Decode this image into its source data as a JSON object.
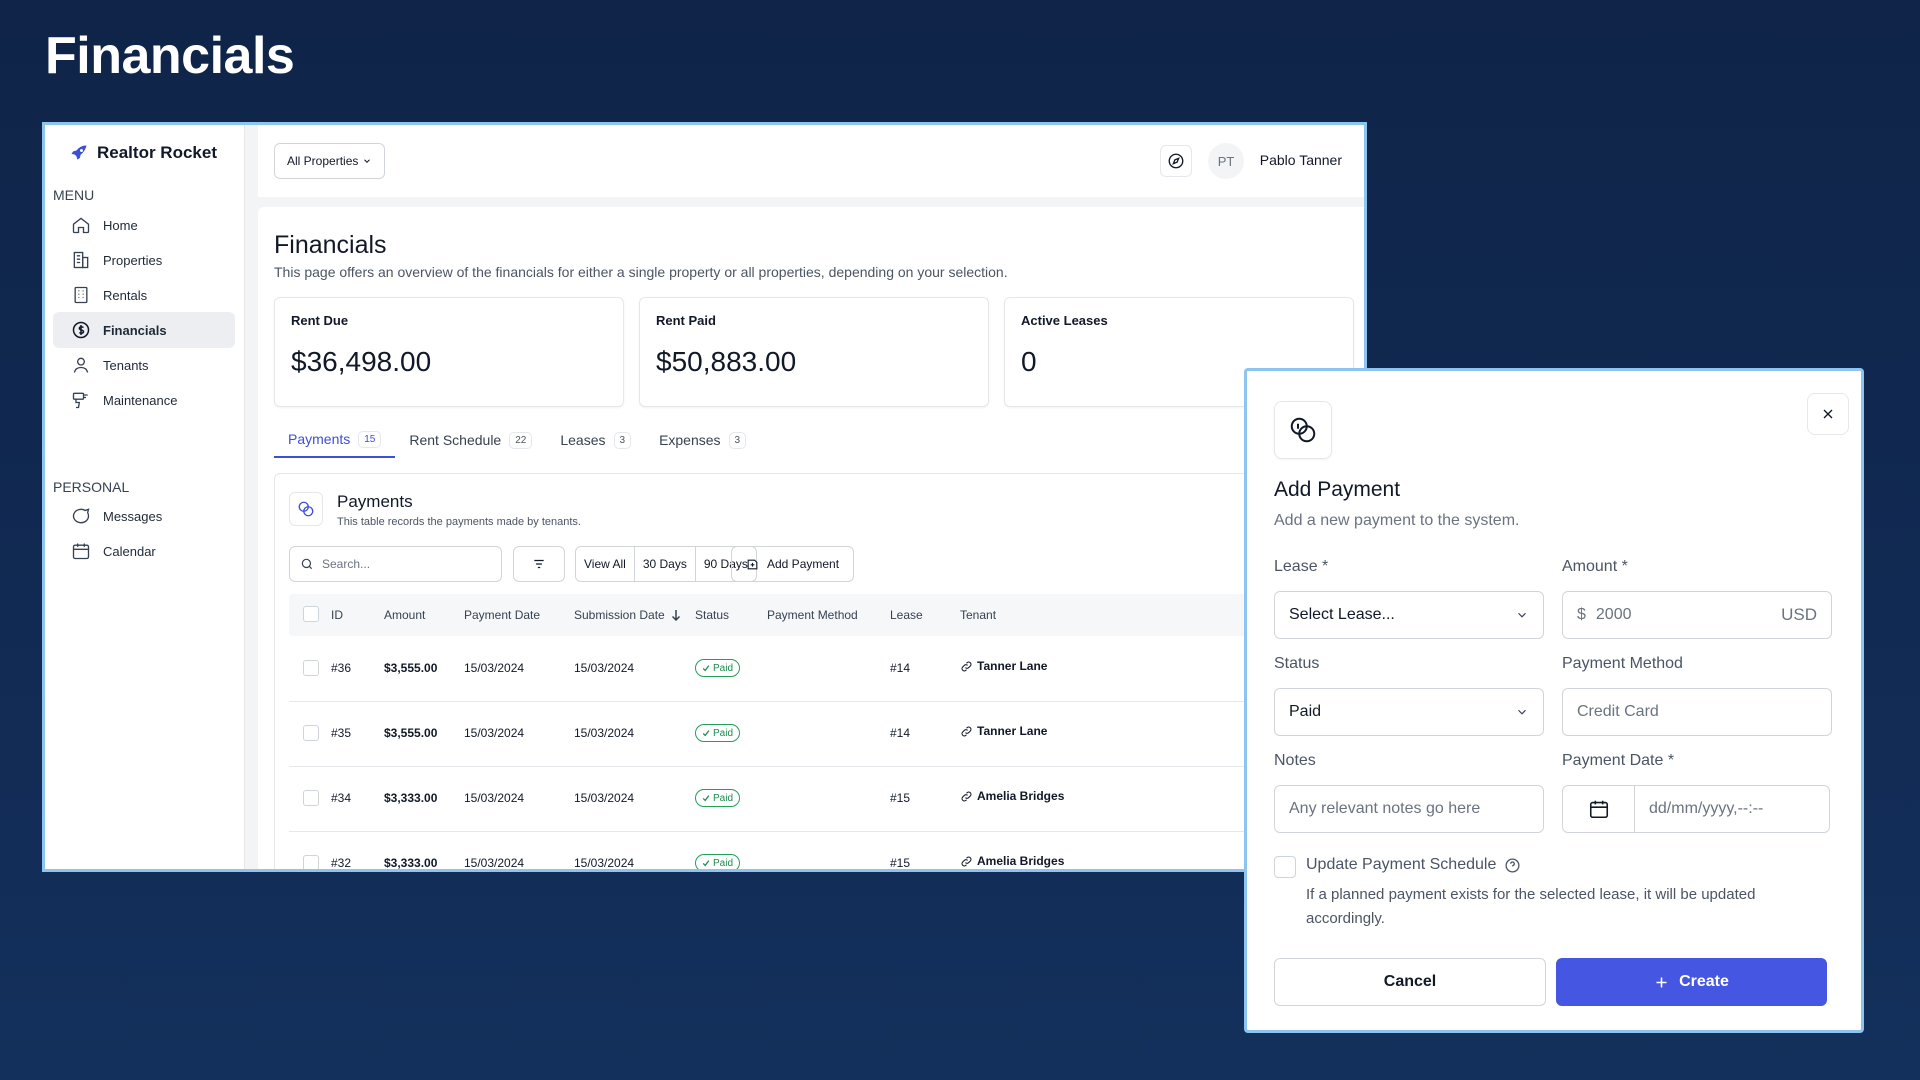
{
  "hero": {
    "title": "Financials"
  },
  "brand": {
    "name": "Realtor Rocket"
  },
  "sidebar": {
    "menu_heading": "MENU",
    "personal_heading": "PERSONAL",
    "items": [
      {
        "label": "Home",
        "icon": "home-icon"
      },
      {
        "label": "Properties",
        "icon": "building-icon"
      },
      {
        "label": "Rentals",
        "icon": "rentals-icon"
      },
      {
        "label": "Financials",
        "icon": "dollar-icon",
        "active": true
      },
      {
        "label": "Tenants",
        "icon": "user-icon"
      },
      {
        "label": "Maintenance",
        "icon": "drill-icon"
      }
    ],
    "personal_items": [
      {
        "label": "Messages",
        "icon": "message-icon"
      },
      {
        "label": "Calendar",
        "icon": "calendar-icon"
      }
    ]
  },
  "topbar": {
    "property_filter": "All Properties",
    "user_initials": "PT",
    "user_name": "Pablo Tanner"
  },
  "page": {
    "title": "Financials",
    "subtitle": "This page offers an overview of the financials for either a single property or all properties, depending on your selection."
  },
  "stats": [
    {
      "label": "Rent Due",
      "value": "$36,498.00"
    },
    {
      "label": "Rent Paid",
      "value": "$50,883.00"
    },
    {
      "label": "Active Leases",
      "value": "0"
    }
  ],
  "tabs": [
    {
      "label": "Payments",
      "count": "15",
      "active": true
    },
    {
      "label": "Rent Schedule",
      "count": "22"
    },
    {
      "label": "Leases",
      "count": "3"
    },
    {
      "label": "Expenses",
      "count": "3"
    }
  ],
  "payments_panel": {
    "title": "Payments",
    "subtitle": "This table records the payments made by tenants.",
    "search_placeholder": "Search...",
    "ranges": [
      "View All",
      "30 Days",
      "90 Days"
    ],
    "add_button": "Add Payment",
    "columns": [
      "ID",
      "Amount",
      "Payment Date",
      "Submission Date",
      "Status",
      "Payment Method",
      "Lease",
      "Tenant"
    ],
    "sort_column": "Submission Date",
    "rows": [
      {
        "id": "#36",
        "amount": "$3,555.00",
        "payment_date": "15/03/2024",
        "submission_date": "15/03/2024",
        "status": "Paid",
        "method": "",
        "lease": "#14",
        "tenant": "Tanner Lane"
      },
      {
        "id": "#35",
        "amount": "$3,555.00",
        "payment_date": "15/03/2024",
        "submission_date": "15/03/2024",
        "status": "Paid",
        "method": "",
        "lease": "#14",
        "tenant": "Tanner Lane"
      },
      {
        "id": "#34",
        "amount": "$3,333.00",
        "payment_date": "15/03/2024",
        "submission_date": "15/03/2024",
        "status": "Paid",
        "method": "",
        "lease": "#15",
        "tenant": "Amelia Bridges"
      },
      {
        "id": "#32",
        "amount": "$3,333.00",
        "payment_date": "15/03/2024",
        "submission_date": "15/03/2024",
        "status": "Paid",
        "method": "",
        "lease": "#15",
        "tenant": "Amelia Bridges"
      }
    ]
  },
  "modal": {
    "title": "Add Payment",
    "subtitle": "Add a new payment to the system.",
    "lease_label": "Lease *",
    "lease_value": "Select Lease...",
    "amount_label": "Amount *",
    "amount_symbol": "$",
    "amount_placeholder": "2000",
    "amount_currency": "USD",
    "status_label": "Status",
    "status_value": "Paid",
    "method_label": "Payment Method",
    "method_placeholder": "Credit Card",
    "notes_label": "Notes",
    "notes_placeholder": "Any relevant notes go here",
    "date_label": "Payment Date *",
    "date_placeholder": "dd/mm/yyyy,--:--",
    "schedule_label": "Update Payment Schedule",
    "schedule_help": "If a planned payment exists for the selected lease, it will be updated accordingly.",
    "cancel_label": "Cancel",
    "create_label": "Create"
  },
  "colors": {
    "background": "#112a53",
    "accent": "#4556e3",
    "paid_badge": "#22a05a",
    "window_border": "#8ec5f0"
  }
}
